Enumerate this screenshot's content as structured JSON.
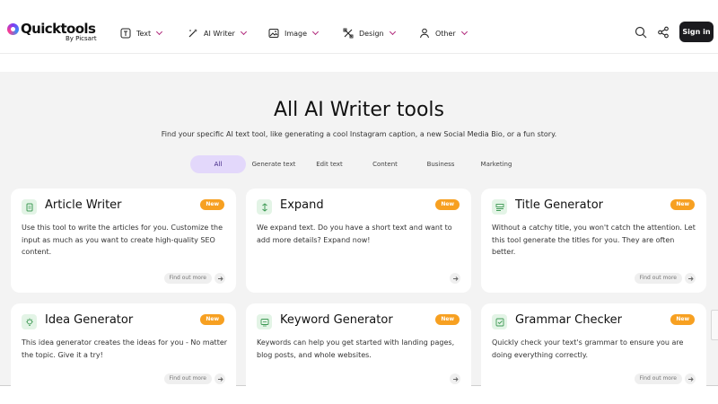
{
  "brand": {
    "name": "Quicktools",
    "byline": "By Picsart"
  },
  "nav": [
    {
      "label": "Text",
      "icon": "text-box-icon"
    },
    {
      "label": "AI Writer",
      "icon": "magic-pen-icon"
    },
    {
      "label": "Image",
      "icon": "image-icon"
    },
    {
      "label": "Design",
      "icon": "design-tools-icon"
    },
    {
      "label": "Other",
      "icon": "shapes-icon"
    }
  ],
  "header_actions": {
    "search_icon": "search-icon",
    "share_icon": "share-icon",
    "signin_label": "Sign in"
  },
  "hero": {
    "title": "All AI Writer tools",
    "subtitle": "Find your specific AI text tool, like generating a cool Instagram caption, a new Social Media Bio, or a fun story."
  },
  "filters": [
    {
      "label": "All",
      "active": true
    },
    {
      "label": "Generate text",
      "active": false
    },
    {
      "label": "Edit text",
      "active": false
    },
    {
      "label": "Content",
      "active": false
    },
    {
      "label": "Business",
      "active": false
    },
    {
      "label": "Marketing",
      "active": false
    }
  ],
  "cards": [
    {
      "title": "Article Writer",
      "badge": "New",
      "description": "Use this tool to write the articles for you. Customize the input as much as you want to create high-quality SEO content.",
      "more": "Find out more",
      "icon": "document-icon"
    },
    {
      "title": "Expand",
      "badge": "New",
      "description": "We expand text. Do you have a short text and want to add more details? Expand now!",
      "more": "",
      "icon": "expand-arrows-icon"
    },
    {
      "title": "Title Generator",
      "badge": "New",
      "description": "Without a catchy title, you won't catch the attention. Let this tool generate the titles for you. They are often better.",
      "more": "Find out more",
      "icon": "title-lines-icon"
    },
    {
      "title": "Idea Generator",
      "badge": "New",
      "description": "This idea generator creates the ideas for you - No matter the topic. Give it a try!",
      "more": "Find out more",
      "icon": "lightbulb-icon"
    },
    {
      "title": "Keyword Generator",
      "badge": "New",
      "description": "Keywords can help you get started with landing pages, blog posts, and whole websites.",
      "more": "",
      "icon": "keyword-screen-icon"
    },
    {
      "title": "Grammar Checker",
      "badge": "New",
      "description": "Quickly check your text's grammar to ensure you are doing everything correctly.",
      "more": "Find out more",
      "icon": "grammar-check-icon"
    }
  ],
  "colors": {
    "accent_purple": "#e3d8fb",
    "badge_orange": "#f7a021",
    "icon_bg_green": "#e3f4e6",
    "icon_green": "#3f9a55",
    "button_dark": "#1b1b1f"
  }
}
